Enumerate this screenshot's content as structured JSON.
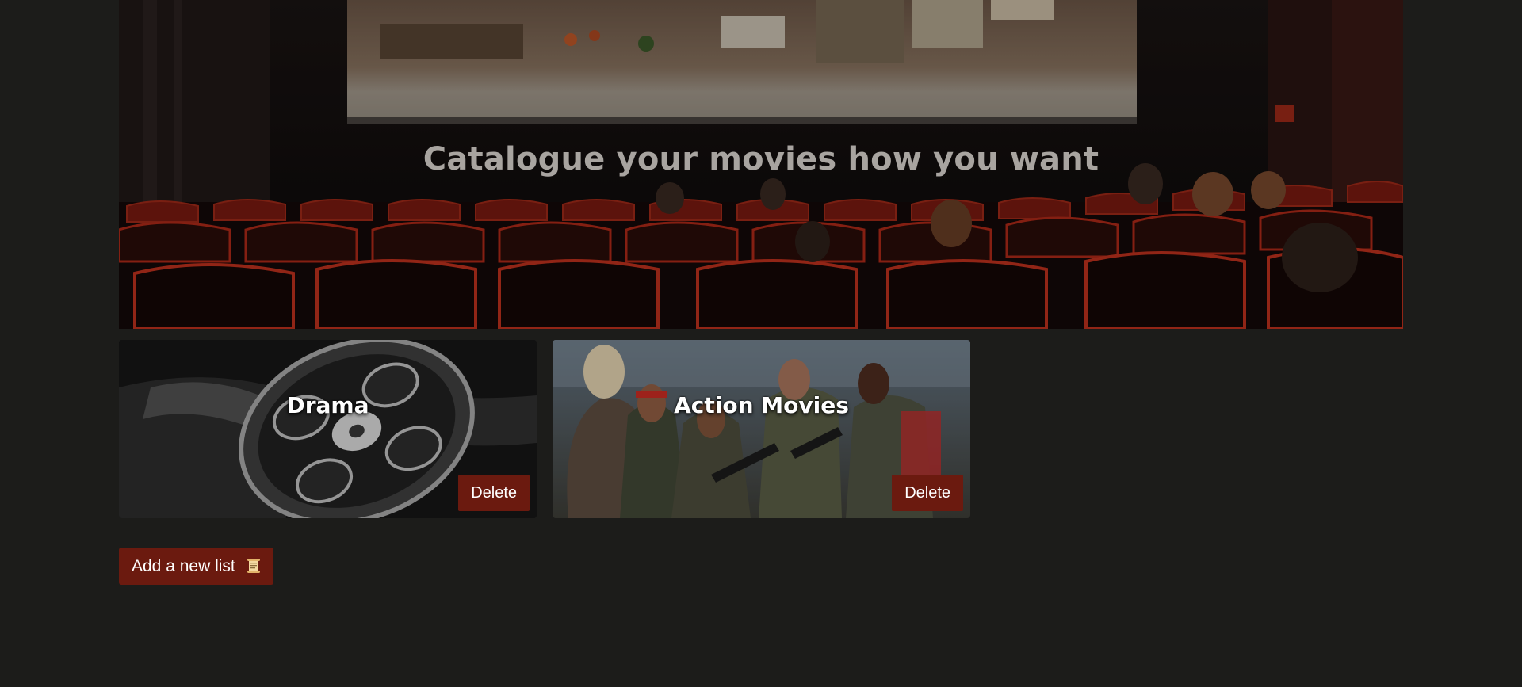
{
  "hero": {
    "title": "Catalogue your movies how you want",
    "image": "cinema-theater-photo"
  },
  "lists": [
    {
      "title": "Drama",
      "image": "film-reel-photo",
      "delete_label": "Delete"
    },
    {
      "title": "Action Movies",
      "image": "action-squad-photo",
      "delete_label": "Delete"
    }
  ],
  "actions": {
    "add_list_label": "Add a new list",
    "add_list_icon": "scroll-icon"
  },
  "colors": {
    "page_background": "#1c1c1a",
    "button_background": "#6b1a0f",
    "title_text": "#a8a4a0"
  }
}
